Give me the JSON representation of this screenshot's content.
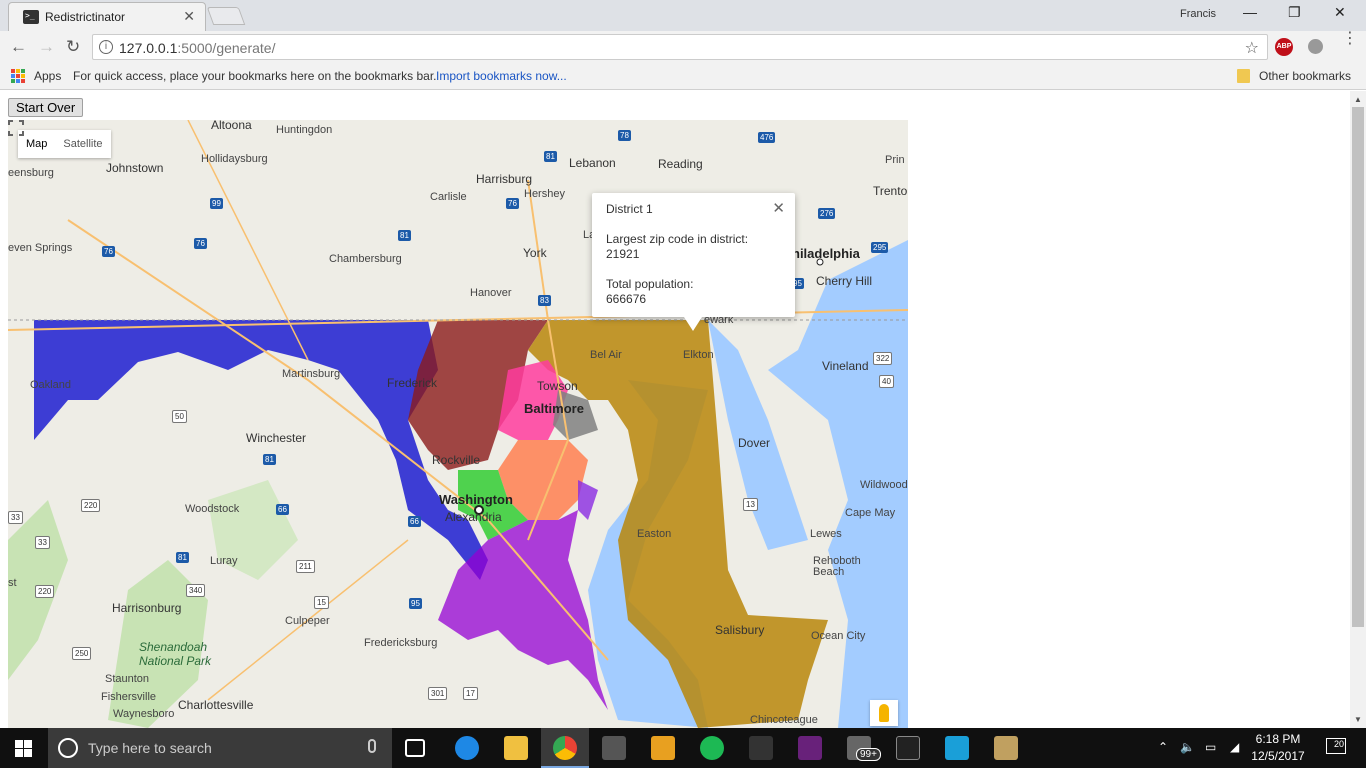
{
  "browser": {
    "tab_title": "Redistrictinator",
    "tab_close": "✕",
    "user": "Francis",
    "minimize": "—",
    "restore": "❐",
    "close": "✕",
    "url_host": "127.0.0.1",
    "url_path": ":5000/generate/",
    "back": "←",
    "forward": "→",
    "reload": "↻",
    "info": "i",
    "star": "☆",
    "abp": "ABP",
    "menu": "⋮"
  },
  "bookmarks": {
    "apps": "Apps",
    "hint": "For quick access, place your bookmarks here on the bookmarks bar.",
    "import_link": "Import bookmarks now...",
    "other": "Other bookmarks"
  },
  "page": {
    "start_over": "Start Over"
  },
  "map": {
    "type_map": "Map",
    "type_satellite": "Satellite",
    "districts": [
      {
        "id": 1,
        "color": "#b8860b"
      },
      {
        "id": 2,
        "color": "#8b1a1a"
      },
      {
        "id": 3,
        "color": "#ff3c9d"
      },
      {
        "id": 4,
        "color": "#8a2be2"
      },
      {
        "id": 5,
        "color": "#9400d3"
      },
      {
        "id": 6,
        "color": "#1010d0"
      },
      {
        "id": 7,
        "color": "#808080"
      },
      {
        "id": 8,
        "color": "#32cd32"
      },
      {
        "id": 9,
        "color": "#ff7f50"
      }
    ],
    "infowindow": {
      "title": "District 1",
      "zip_label": "Largest zip code in district:",
      "zip_value": "21921",
      "pop_label": "Total population:",
      "pop_value": "666676",
      "close": "✕"
    },
    "labels": {
      "altoona": "Altoona",
      "huntingdon": "Huntingdon",
      "hollidaysburg": "Hollidaysburg",
      "johnstown": "Johnstown",
      "greensburg": "eensburg",
      "lebanon": "Lebanon",
      "reading": "Reading",
      "harrisburg": "Harrisburg",
      "hershey": "Hershey",
      "carlisle": "Carlisle",
      "york": "York",
      "lancaster": "La",
      "philadelphia": "hiladelphia",
      "cherry_hill": "Cherry Hill",
      "trenton": "Trento",
      "princeton": "Prin",
      "seven_springs": "even Springs",
      "chambersburg": "Chambersburg",
      "hanover": "Hanover",
      "newark": "ewark",
      "vineland": "Vineland",
      "oakland": "Oakland",
      "martinsburg": "Martinsburg",
      "frederick": "Frederick",
      "towson": "Towson",
      "baltimore": "Baltimore",
      "bel_air": "Bel Air",
      "elkton": "Elkton",
      "winchester": "Winchester",
      "rockville": "Rockville",
      "dover": "Dover",
      "washington": "Washington",
      "alexandria": "Alexandria",
      "woodstock": "Woodstock",
      "wildwood": "Wildwood",
      "cape_may": "Cape May",
      "lewes": "Lewes",
      "rehoboth": "Rehoboth\nBeach",
      "easton": "Easton",
      "luray": "Luray",
      "harrisonburg": "Harrisonburg",
      "culpeper": "Culpeper",
      "salisbury": "Salisbury",
      "ocean_city": "Ocean City",
      "fredericksburg": "Fredericksburg",
      "shenandoah": "Shenandoah\nNational Park",
      "staunton": "Staunton",
      "charlottesville": "Charlottesville",
      "fishersville": "Fishersville",
      "waynesboro": "Waynesboro",
      "chincoteague": "Chincoteague",
      "st": "st"
    }
  },
  "taskbar": {
    "search_placeholder": "Type here to search",
    "time": "6:18 PM",
    "date": "12/5/2017",
    "notifications": "20",
    "badge": "99+"
  }
}
